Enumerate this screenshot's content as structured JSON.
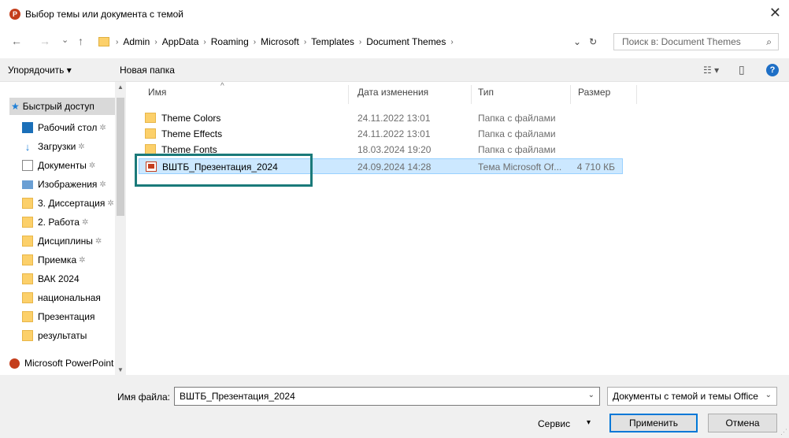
{
  "window": {
    "app_icon_letter": "P",
    "title": "Выбор темы или документа с темой",
    "close_glyph": "✕"
  },
  "nav": {
    "back": "←",
    "forward": "→",
    "recent": "⌄",
    "up": "↑",
    "breadcrumbs": [
      "Admin",
      "AppData",
      "Roaming",
      "Microsoft",
      "Templates",
      "Document Themes"
    ],
    "sep": "›",
    "dropdown": "⌄",
    "refresh": "↻",
    "search_placeholder": "Поиск в: Document Themes",
    "search_icon": "⌕"
  },
  "toolbar": {
    "organize": "Упорядочить ▾",
    "new_folder": "Новая папка",
    "view_icon": "☷ ▾",
    "pane_icon": "▯",
    "help": "?"
  },
  "sidebar": {
    "quick_access": "Быстрый доступ",
    "items": [
      {
        "label": "Рабочий стол",
        "icon": "desktop-icon",
        "pinned": true
      },
      {
        "label": "Загрузки",
        "icon": "download-icon",
        "pinned": true
      },
      {
        "label": "Документы",
        "icon": "documents-icon",
        "pinned": true
      },
      {
        "label": "Изображения",
        "icon": "pictures-icon",
        "pinned": true
      },
      {
        "label": "3. Диссертация",
        "icon": "folder-icon",
        "pinned": true
      },
      {
        "label": "2. Работа",
        "icon": "folder-icon",
        "pinned": true
      },
      {
        "label": "Дисциплины",
        "icon": "folder-icon",
        "pinned": true
      },
      {
        "label": "Приемка",
        "icon": "folder-icon",
        "pinned": true
      },
      {
        "label": "ВАК 2024",
        "icon": "folder-icon",
        "pinned": false
      },
      {
        "label": "национальная",
        "icon": "folder-icon",
        "pinned": false
      },
      {
        "label": "Презентация",
        "icon": "folder-icon",
        "pinned": false
      },
      {
        "label": "результаты",
        "icon": "folder-icon",
        "pinned": false
      }
    ],
    "powerpoint": "Microsoft PowerPoint",
    "pin_glyph": "✲"
  },
  "columns": {
    "name": "Имя",
    "date": "Дата изменения",
    "type": "Тип",
    "size": "Размер",
    "sort_caret": "^"
  },
  "files": [
    {
      "name": "Theme Colors",
      "date": "24.11.2022 13:01",
      "type": "Папка с файлами",
      "size": "",
      "kind": "folder"
    },
    {
      "name": "Theme Effects",
      "date": "24.11.2022 13:01",
      "type": "Папка с файлами",
      "size": "",
      "kind": "folder"
    },
    {
      "name": "Theme Fonts",
      "date": "18.03.2024 19:20",
      "type": "Папка с файлами",
      "size": "",
      "kind": "folder"
    },
    {
      "name": "ВШТБ_Презентация_2024",
      "date": "24.09.2024 14:28",
      "type": "Тема Microsoft Of...",
      "size": "4 710 КБ",
      "kind": "thmx",
      "selected": true
    }
  ],
  "bottom": {
    "filename_label": "Имя файла:",
    "filename_value": "ВШТБ_Презентация_2024",
    "filetype_value": "Документы с темой и темы Office",
    "tools": "Сервис",
    "tools_caret": "▾",
    "apply": "Применить",
    "cancel": "Отмена",
    "dd": "⌄"
  },
  "colors": {
    "selection": "#cce8ff",
    "highlight_box": "#1a7a7a",
    "folder": "#fcd06a",
    "accent": "#0078d7"
  }
}
